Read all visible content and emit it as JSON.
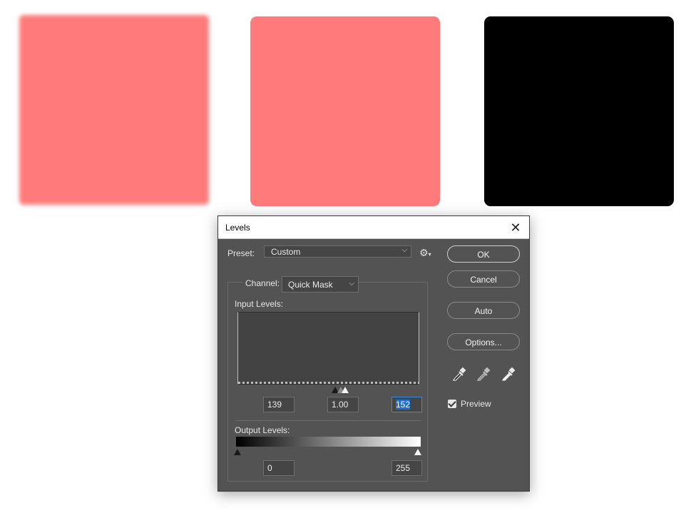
{
  "canvas": {
    "swatches": [
      {
        "name": "blurred-swatch",
        "color": "#ff7b7b"
      },
      {
        "name": "rounded-swatch",
        "color": "#ff7b7b"
      },
      {
        "name": "black-swatch",
        "color": "#000000"
      }
    ]
  },
  "dialog": {
    "title": "Levels",
    "close_icon": "close-icon",
    "preset_label": "Preset:",
    "preset_value": "Custom",
    "settings_icon": "gear-icon",
    "channel_label": "Channel:",
    "channel_value": "Quick Mask",
    "input_levels_label": "Input Levels:",
    "input_levels": {
      "black": "139",
      "gamma": "1.00",
      "white": "152"
    },
    "output_levels_label": "Output Levels:",
    "output_levels": {
      "black": "0",
      "white": "255"
    },
    "buttons": {
      "ok": "OK",
      "cancel": "Cancel",
      "auto": "Auto",
      "options": "Options..."
    },
    "eyedroppers": [
      "black-point-eyedropper-icon",
      "gray-point-eyedropper-icon",
      "white-point-eyedropper-icon"
    ],
    "preview_label": "Preview",
    "preview_checked": true
  }
}
